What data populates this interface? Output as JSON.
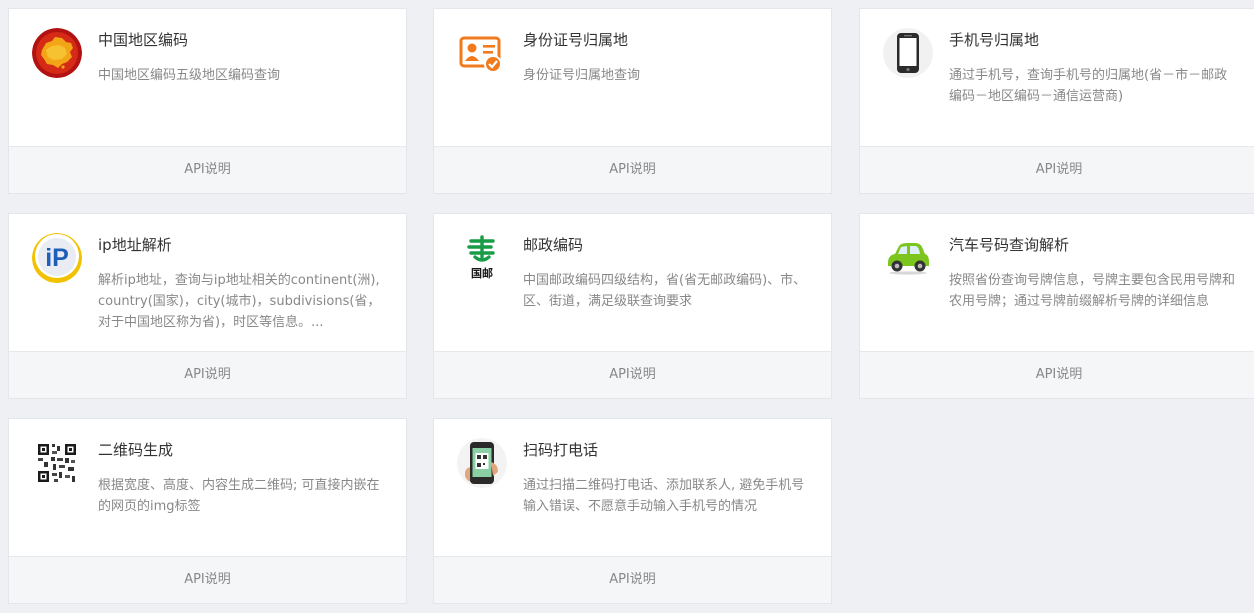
{
  "cards": [
    {
      "title": "中国地区编码",
      "desc": "中国地区编码五级地区编码查询",
      "link": "API说明",
      "icon": "china-map-icon"
    },
    {
      "title": "身份证号归属地",
      "desc": "身份证号归属地查询",
      "link": "API说明",
      "icon": "id-card-icon"
    },
    {
      "title": "手机号归属地",
      "desc": "通过手机号，查询手机号的归属地(省－市－邮政编码－地区编码－通信运营商)",
      "link": "API说明",
      "icon": "mobile-phone-icon"
    },
    {
      "title": "ip地址解析",
      "desc": "解析ip地址，查询与ip地址相关的continent(洲), country(国家)，city(城市)，subdivisions(省，对于中国地区称为省)，时区等信息。...",
      "link": "API说明",
      "icon": "ip-icon"
    },
    {
      "title": "邮政编码",
      "desc": "中国邮政编码四级结构，省(省无邮政编码)、市、区、街道，满足级联查询要求",
      "link": "API说明",
      "icon": "china-post-icon"
    },
    {
      "title": "汽车号码查询解析",
      "desc": "按照省份查询号牌信息，号牌主要包含民用号牌和农用号牌；通过号牌前缀解析号牌的详细信息",
      "link": "API说明",
      "icon": "car-icon"
    },
    {
      "title": "二维码生成",
      "desc": "根据宽度、高度、内容生成二维码; 可直接内嵌在的网页的img标签",
      "link": "API说明",
      "icon": "qr-code-icon"
    },
    {
      "title": "扫码打电话",
      "desc": "通过扫描二维码打电话、添加联系人, 避免手机号输入错误、不愿意手动输入手机号的情况",
      "link": "API说明",
      "icon": "phone-scan-icon"
    }
  ],
  "icon_badge_text": {
    "ip": "iP",
    "post": "国邮"
  },
  "colors": {
    "background": "#eef0f4",
    "card": "#ffffff",
    "footer": "#f5f6f8",
    "title": "#333333",
    "desc": "#888888"
  }
}
